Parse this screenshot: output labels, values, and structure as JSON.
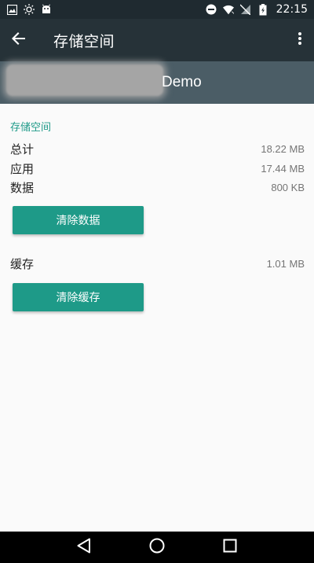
{
  "status_bar": {
    "time": "22:15",
    "left_icons": [
      "image-icon",
      "brightness-icon",
      "android-icon"
    ],
    "right_icons": [
      "dnd-icon",
      "wifi-icon",
      "no-sim-icon",
      "battery-charging-icon"
    ]
  },
  "toolbar": {
    "title": "存储空间",
    "background": "#263238"
  },
  "app_header": {
    "app_name": "Demo",
    "background": "#4b5d66"
  },
  "storage": {
    "section_title": "存储空间",
    "rows": [
      {
        "label": "总计",
        "value": "18.22 MB"
      },
      {
        "label": "应用",
        "value": "17.44 MB"
      },
      {
        "label": "数据",
        "value": "800 KB"
      }
    ],
    "clear_data_label": "清除数据"
  },
  "cache": {
    "label": "缓存",
    "value": "1.01 MB",
    "clear_cache_label": "清除缓存"
  },
  "colors": {
    "accent": "#1e9a88",
    "page_background": "#fafafa"
  }
}
